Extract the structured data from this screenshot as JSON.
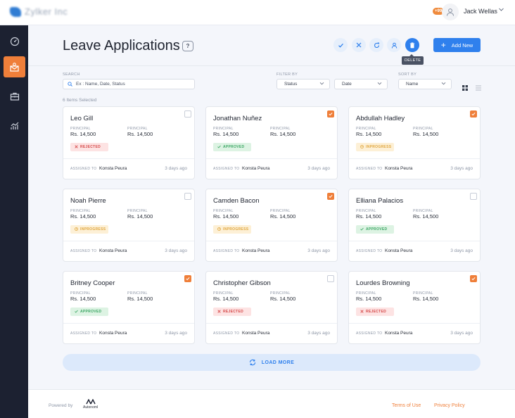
{
  "app": {
    "logo_text": "Zylker Inc"
  },
  "header": {
    "notification_count": "+99",
    "user_name": "Jack Wellas"
  },
  "page": {
    "title": "Leave Applications",
    "help_label": "?",
    "tooltip": "DELETE",
    "add_button": "Add New"
  },
  "filters": {
    "search_label": "SEARCH",
    "search_placeholder": "Ex : Name, Date, Status",
    "filter_label": "FILTER BY",
    "status_select": "Status",
    "date_select": "Date",
    "sort_label": "SORT BY",
    "sort_select": "Name"
  },
  "selected_count": "6 Items Selected",
  "card_labels": {
    "principal": "PRINCIPAL",
    "assigned_to": "ASSIGNED TO"
  },
  "cards": [
    {
      "name": "Leo Gill",
      "principal1": "Rs. 14,500",
      "principal2": "Rs. 14,500",
      "status": "REJECTED",
      "assignee": "Konsta Peura",
      "time": "3 days ago",
      "checked": false
    },
    {
      "name": "Jonathan Nuñez",
      "principal1": "Rs. 14,500",
      "principal2": "Rs. 14,500",
      "status": "APPROVED",
      "assignee": "Konsta Peura",
      "time": "3 days ago",
      "checked": true
    },
    {
      "name": "Abdullah Hadley",
      "principal1": "Rs. 14,500",
      "principal2": "Rs. 14,500",
      "status": "INPROGRESS",
      "assignee": "Konsta Peura",
      "time": "3 days ago",
      "checked": true
    },
    {
      "name": "Noah Pierre",
      "principal1": "Rs. 14,500",
      "principal2": "Rs. 14,500",
      "status": "INPROGRESS",
      "assignee": "Konsta Peura",
      "time": "3 days ago",
      "checked": false
    },
    {
      "name": "Camden Bacon",
      "principal1": "Rs. 14,500",
      "principal2": "Rs. 14,500",
      "status": "INPROGRESS",
      "assignee": "Konsta Peura",
      "time": "3 days ago",
      "checked": true
    },
    {
      "name": "Elliana Palacios",
      "principal1": "Rs. 14,500",
      "principal2": "Rs. 14,500",
      "status": "APPROVED",
      "assignee": "Konsta Peura",
      "time": "3 days ago",
      "checked": false
    },
    {
      "name": "Britney Cooper",
      "principal1": "Rs. 14,500",
      "principal2": "Rs. 14,500",
      "status": "APPROVED",
      "assignee": "Konsta Peura",
      "time": "3 days ago",
      "checked": true
    },
    {
      "name": "Christopher Gibson",
      "principal1": "Rs. 14,500",
      "principal2": "Rs. 14,500",
      "status": "REJECTED",
      "assignee": "Konsta Peura",
      "time": "3 days ago",
      "checked": false
    },
    {
      "name": "Lourdes Browning",
      "principal1": "Rs. 14,500",
      "principal2": "Rs. 14,500",
      "status": "REJECTED",
      "assignee": "Konsta Peura",
      "time": "3 days ago",
      "checked": true
    }
  ],
  "load_more": "LOAD MORE",
  "footer": {
    "powered_by": "Powered by",
    "brand": "AutonomI",
    "terms": "Terms of Use",
    "privacy": "Privacy Policy"
  },
  "icons": {
    "sidebar": [
      "dashboard-icon",
      "leave-mail-icon",
      "briefcase-icon",
      "analytics-icon"
    ],
    "actions": [
      "check-icon",
      "close-icon",
      "refresh-icon",
      "user-icon",
      "trash-icon"
    ]
  },
  "colors": {
    "accent": "#ef7f3a",
    "primary": "#2f80ed",
    "sidebar": "#1c2131",
    "rejected": "#d64b4b",
    "approved": "#3ea866",
    "inprogress": "#e0a740"
  }
}
